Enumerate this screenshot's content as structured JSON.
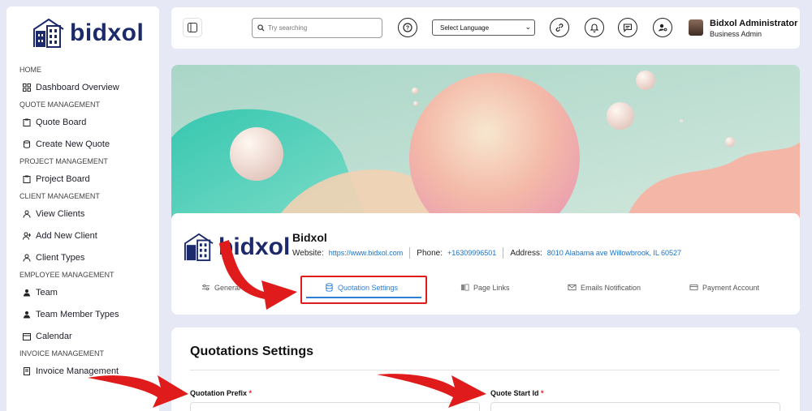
{
  "brand": {
    "name": "bidxol"
  },
  "sidebar": {
    "sections": [
      {
        "title": "HOME",
        "items": [
          {
            "label": "Dashboard Overview",
            "icon": "grid-icon"
          }
        ]
      },
      {
        "title": "QUOTE MANAGEMENT",
        "items": [
          {
            "label": "Quote Board",
            "icon": "clipboard-icon"
          },
          {
            "label": "Create New Quote",
            "icon": "database-icon"
          }
        ]
      },
      {
        "title": "PROJECT MANAGEMENT",
        "items": [
          {
            "label": "Project Board",
            "icon": "clipboard-icon"
          }
        ]
      },
      {
        "title": "CLIENT MANAGEMENT",
        "items": [
          {
            "label": "View Clients",
            "icon": "user-icon"
          },
          {
            "label": "Add New Client",
            "icon": "user-plus-icon"
          },
          {
            "label": "Client Types",
            "icon": "user-icon"
          }
        ]
      },
      {
        "title": "EMPLOYEE MANAGEMENT",
        "items": [
          {
            "label": "Team",
            "icon": "user-filled-icon"
          },
          {
            "label": "Team Member Types",
            "icon": "user-filled-icon"
          },
          {
            "label": "Calendar",
            "icon": "calendar-icon"
          }
        ]
      },
      {
        "title": "INVOICE MANAGEMENT",
        "items": [
          {
            "label": "Invoice Management",
            "icon": "invoice-icon"
          }
        ]
      }
    ]
  },
  "header": {
    "search_placeholder": "Try searching",
    "language": "Select Language",
    "user_name": "Bidxol Administrator",
    "user_role": "Business Admin"
  },
  "company": {
    "name": "Bidxol",
    "website_label": "Website:",
    "website": "https://www.bidxol.com",
    "phone_label": "Phone:",
    "phone": "+16309996501",
    "address_label": "Address:",
    "address": "8010 Alabama ave Willowbrook, IL 60527"
  },
  "tabs": [
    {
      "label": "General",
      "icon": "sliders-icon"
    },
    {
      "label": "Quotation Settings",
      "icon": "database-icon"
    },
    {
      "label": "Page Links",
      "icon": "book-icon"
    },
    {
      "label": "Emails Notification",
      "icon": "mail-icon"
    },
    {
      "label": "Payment Account",
      "icon": "card-icon"
    }
  ],
  "active_tab": "Quotation Settings",
  "settings": {
    "title": "Quotations Settings",
    "field1_label": "Quotation Prefix",
    "field2_label": "Quote Start Id",
    "required_mark": "*"
  },
  "colors": {
    "accent": "#2e7fd6",
    "brand": "#1c2a6b",
    "annotation": "#e01b1b"
  }
}
